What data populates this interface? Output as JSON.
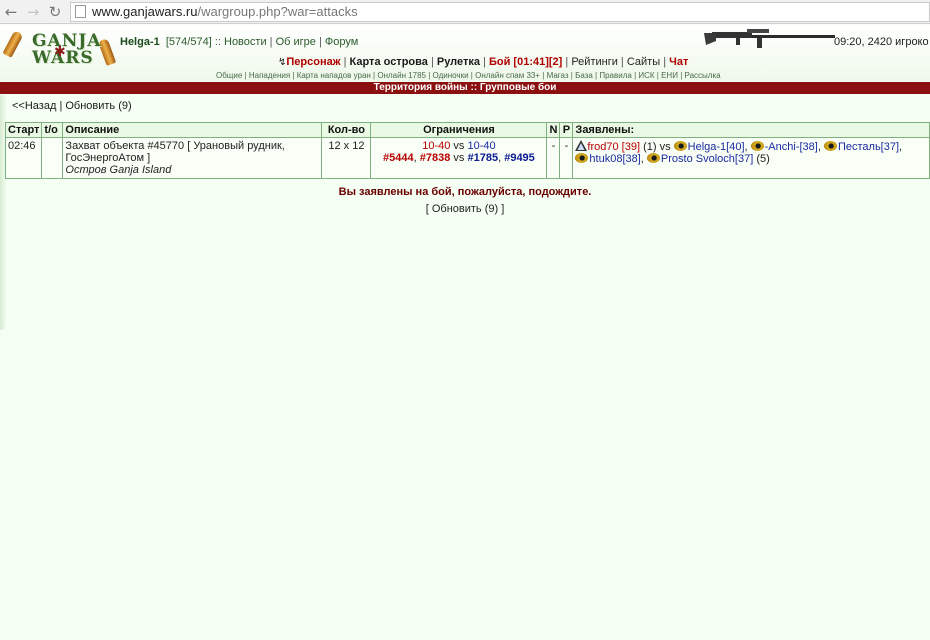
{
  "browser": {
    "back_icon": "back-arrow-icon",
    "forward_icon": "forward-arrow-icon",
    "reload_icon": "reload-icon",
    "url_domain": "www.ganjawars.ru",
    "url_path": "/wargroup.php?war=attacks"
  },
  "header": {
    "logo_line1": "GANJA",
    "logo_line2": "WARS",
    "user_name": "Helga-1",
    "hp": "[574/574]",
    "links": [
      "Новости",
      "Об игре",
      "Форум"
    ],
    "time_online": "09:20, 2420 игроко"
  },
  "main_menu": {
    "personage": "Персонаж",
    "island_map": "Карта острова",
    "roulette": "Рулетка",
    "battle": "Бой [01:41][2]",
    "ratings": "Рейтинги",
    "sites": "Сайты",
    "chat": "Чат"
  },
  "sub_menu": [
    "Общие",
    "Нападения",
    "Карта нападов уран",
    "Онлайн 1785",
    "Одиночки",
    "Онлайн спам 33+",
    "Магаз",
    "База",
    "Правила",
    "ИСК",
    "ЕНИ",
    "Рассылка"
  ],
  "title_bar": "Территория войны :: Групповые бои",
  "nav": {
    "back": "<<Назад",
    "refresh": "Обновить (9)"
  },
  "table": {
    "headers": {
      "start": "Старт",
      "to": "t/o",
      "description": "Описание",
      "count": "Кол-во",
      "limits": "Ограничения",
      "n": "N",
      "p": "P",
      "applied": "Заявлены:"
    },
    "row": {
      "start": "02:46",
      "to": "",
      "desc_line1": "Захват объекта #45770 [ Урановый рудник,",
      "desc_line2": "ГосЭнергоАтом ]",
      "desc_sub": "Остров Ganja Island",
      "count": "12 x 12",
      "limit_left": "10-40",
      "limit_vs": "vs",
      "limit_right": "10-40",
      "synd1": "#5444",
      "synd2": "#7838",
      "synd_vs": "vs",
      "synd3": "#1785",
      "synd4": "#9495",
      "n": "-",
      "p": "-",
      "p1": "frod70 [39]",
      "p1_suffix": "(1) vs",
      "p2": "Helga-1[40]",
      "p3": "-Anchi-[38]",
      "p4": "Песталь[37]",
      "p5": "htuk08[38]",
      "p6": "Prosto Svoloch[37]",
      "p6_suffix": "(5)"
    }
  },
  "status_message": "Вы заявлены на бой, пожалуйста, подождите.",
  "refresh_bottom": "[ Обновить (9) ]",
  "colors": {
    "background": "#f5fff3",
    "title_bar": "#8b1010",
    "border": "#80b080",
    "red": "#b80000",
    "blue": "#1a2aa0"
  }
}
